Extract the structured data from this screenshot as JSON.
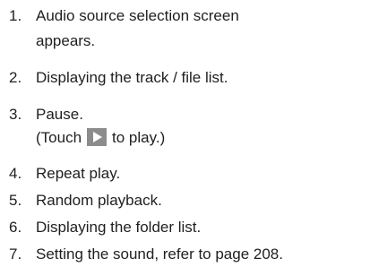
{
  "steps": [
    {
      "num": "1.",
      "text": "Audio source selection screen",
      "cont": "appears."
    },
    {
      "num": "2.",
      "text": "Displaying the track / file list."
    },
    {
      "num": "3.",
      "text": "Pause.",
      "cont_before": "(Touch",
      "cont_after": "to play.)",
      "icon": "play-icon"
    },
    {
      "num": "4.",
      "text": "Repeat play."
    },
    {
      "num": "5.",
      "text": "Random playback."
    },
    {
      "num": "6.",
      "text": "Displaying the folder list."
    },
    {
      "num": "7.",
      "text": "Setting the sound, refer to page 208."
    }
  ]
}
